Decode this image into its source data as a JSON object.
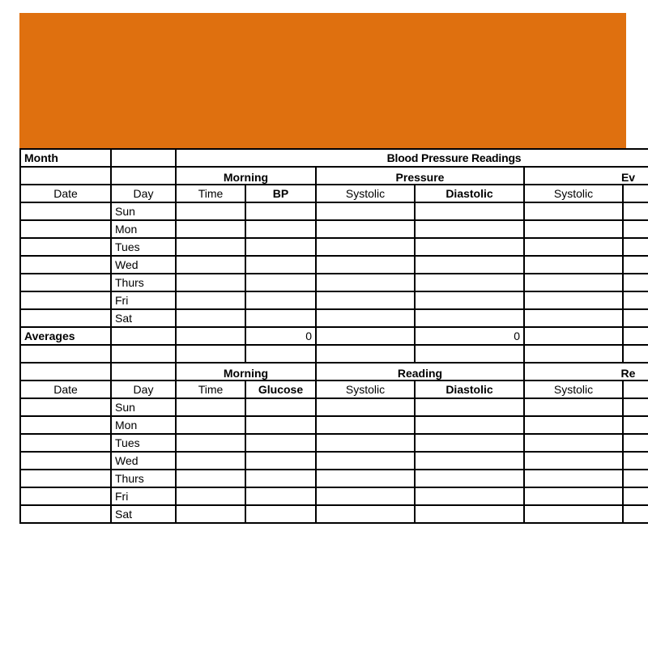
{
  "banner": {
    "color": "#df700f"
  },
  "palette": {
    "orange": "#df700f",
    "gray": "#c4c4c4",
    "cyan": "#ccfbfb",
    "purple": "#bf82ef",
    "border": "#000000"
  },
  "sheet": {
    "month_label": "Month",
    "title": "Blood Pressure Readings"
  },
  "tables": [
    {
      "groups": {
        "morning": "Morning",
        "pressure": "Pressure",
        "evening": "Ev"
      },
      "headers": {
        "date": "Date",
        "day": "Day",
        "time": "Time",
        "key": "BP",
        "systolic": "Systolic",
        "diastolic": "Diastolic",
        "systolic2": "Systolic"
      },
      "rows": [
        {
          "date": "",
          "day": "Sun",
          "time": "",
          "key": "",
          "systolic": "",
          "diastolic": "",
          "systolic2": ""
        },
        {
          "date": "",
          "day": "Mon",
          "time": "",
          "key": "",
          "systolic": "",
          "diastolic": "",
          "systolic2": ""
        },
        {
          "date": "",
          "day": "Tues",
          "time": "",
          "key": "",
          "systolic": "",
          "diastolic": "",
          "systolic2": ""
        },
        {
          "date": "",
          "day": "Wed",
          "time": "",
          "key": "",
          "systolic": "",
          "diastolic": "",
          "systolic2": ""
        },
        {
          "date": "",
          "day": "Thurs",
          "time": "",
          "key": "",
          "systolic": "",
          "diastolic": "",
          "systolic2": ""
        },
        {
          "date": "",
          "day": "Fri",
          "time": "",
          "key": "",
          "systolic": "",
          "diastolic": "",
          "systolic2": ""
        },
        {
          "date": "",
          "day": "Sat",
          "time": "",
          "key": "",
          "systolic": "",
          "diastolic": "",
          "systolic2": ""
        }
      ],
      "averages": {
        "label": "Averages",
        "day": "",
        "time": "",
        "key": "0",
        "systolic": "",
        "diastolic": "0",
        "systolic2": ""
      }
    },
    {
      "groups": {
        "morning": "Morning",
        "pressure": "Reading",
        "evening": "Re"
      },
      "headers": {
        "date": "Date",
        "day": "Day",
        "time": "Time",
        "key": "Glucose",
        "systolic": "Systolic",
        "diastolic": "Diastolic",
        "systolic2": "Systolic"
      },
      "rows": [
        {
          "date": "",
          "day": "Sun",
          "time": "",
          "key": "",
          "systolic": "",
          "diastolic": "",
          "systolic2": ""
        },
        {
          "date": "",
          "day": "Mon",
          "time": "",
          "key": "",
          "systolic": "",
          "diastolic": "",
          "systolic2": ""
        },
        {
          "date": "",
          "day": "Tues",
          "time": "",
          "key": "",
          "systolic": "",
          "diastolic": "",
          "systolic2": ""
        },
        {
          "date": "",
          "day": "Wed",
          "time": "",
          "key": "",
          "systolic": "",
          "diastolic": "",
          "systolic2": ""
        },
        {
          "date": "",
          "day": "Thurs",
          "time": "",
          "key": "",
          "systolic": "",
          "diastolic": "",
          "systolic2": ""
        },
        {
          "date": "",
          "day": "Fri",
          "time": "",
          "key": "",
          "systolic": "",
          "diastolic": "",
          "systolic2": ""
        },
        {
          "date": "",
          "day": "Sat",
          "time": "",
          "key": "",
          "systolic": "",
          "diastolic": "",
          "systolic2": ""
        }
      ]
    }
  ]
}
